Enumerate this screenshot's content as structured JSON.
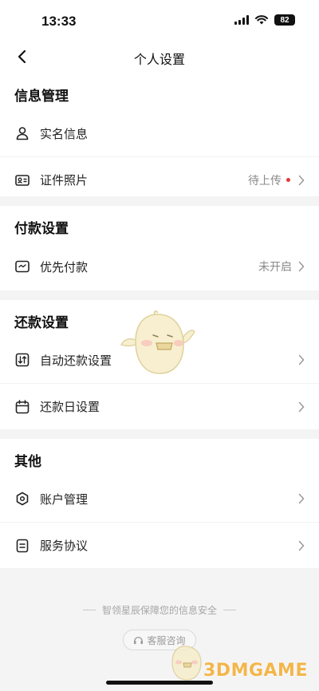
{
  "status_bar": {
    "time": "13:33",
    "battery": "82"
  },
  "nav": {
    "title": "个人设置"
  },
  "sections": [
    {
      "title": "信息管理",
      "items": [
        {
          "label": "实名信息",
          "icon": "person-icon"
        },
        {
          "label": "证件照片",
          "icon": "id-card-icon",
          "value": "待上传",
          "dot": true
        }
      ]
    },
    {
      "title": "付款设置",
      "items": [
        {
          "label": "优先付款",
          "icon": "payment-icon",
          "value": "未开启"
        }
      ]
    },
    {
      "title": "还款设置",
      "items": [
        {
          "label": "自动还款设置",
          "icon": "auto-repay-icon"
        },
        {
          "label": "还款日设置",
          "icon": "calendar-icon"
        }
      ]
    },
    {
      "title": "其他",
      "items": [
        {
          "label": "账户管理",
          "icon": "account-icon"
        },
        {
          "label": "服务协议",
          "icon": "document-icon"
        }
      ]
    }
  ],
  "footer": {
    "note": "智领星辰保障您的信息安全",
    "customer_service": "客服咨询"
  },
  "watermark": "3DMGAME",
  "colors": {
    "background": "#f4f4f5",
    "dot": "#e53935",
    "watermark": "#f3b64a"
  }
}
